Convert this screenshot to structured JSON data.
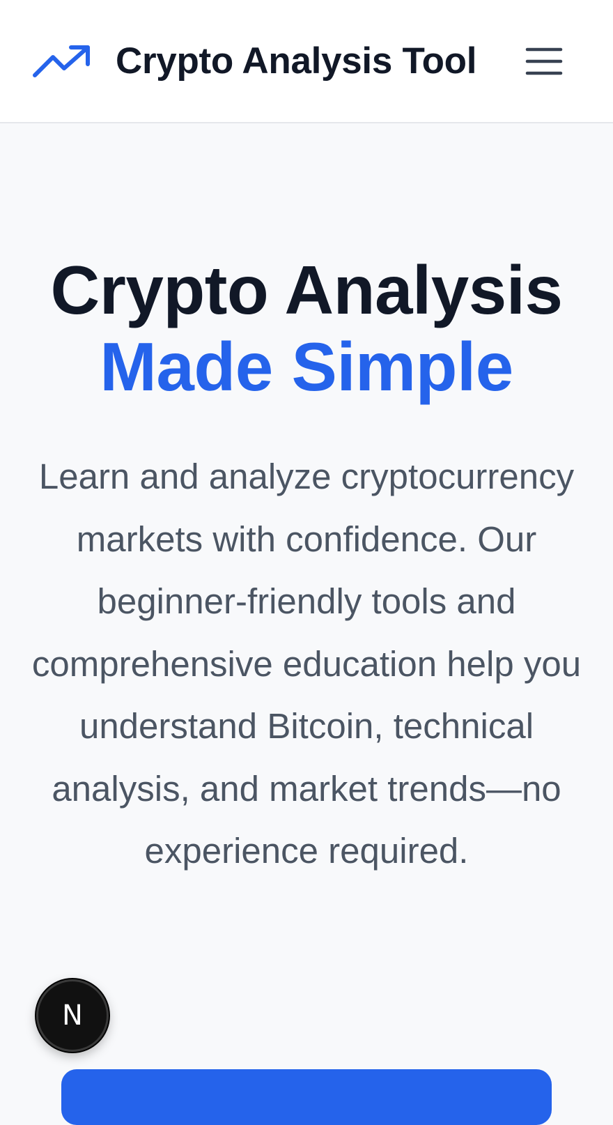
{
  "header": {
    "brand": "Crypto Analysis Tool",
    "logo_icon": "trending-up-icon",
    "menu_icon": "hamburger-menu-icon"
  },
  "hero": {
    "title_line1": "Crypto Analysis",
    "title_line2": "Made Simple",
    "description": "Learn and analyze cryptocurrency markets with confidence. Our beginner-friendly tools and comprehensive education help you understand Bitcoin, technical analysis, and market trends—no experience required."
  },
  "dev_badge": {
    "label": "N"
  },
  "colors": {
    "accent": "#2563eb",
    "heading": "#111827",
    "body_text": "#4b5563",
    "page_bg": "#f8f9fb",
    "header_bg": "#ffffff"
  }
}
